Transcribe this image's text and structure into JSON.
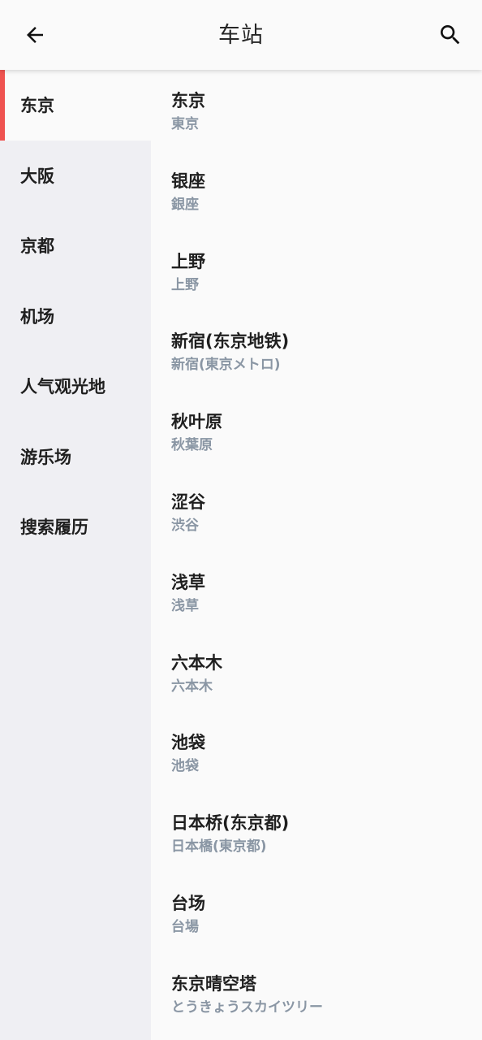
{
  "header": {
    "title": "车站",
    "back_icon": "back-arrow-icon",
    "search_icon": "search-icon"
  },
  "colors": {
    "accent": "#ef5350",
    "sidebar_bg": "#efeff3",
    "subtitle": "#8a96a4"
  },
  "sidebar": {
    "active_index": 0,
    "items": [
      {
        "label": "东京"
      },
      {
        "label": "大阪"
      },
      {
        "label": "京都"
      },
      {
        "label": "机场"
      },
      {
        "label": "人气观光地"
      },
      {
        "label": "游乐场"
      },
      {
        "label": "搜索履历"
      }
    ]
  },
  "stations": [
    {
      "name": "东京",
      "sub": "東京"
    },
    {
      "name": "银座",
      "sub": "銀座"
    },
    {
      "name": "上野",
      "sub": "上野"
    },
    {
      "name": "新宿(东京地铁)",
      "sub": "新宿(東京メトロ)"
    },
    {
      "name": "秋叶原",
      "sub": "秋葉原"
    },
    {
      "name": "涩谷",
      "sub": "渋谷"
    },
    {
      "name": "浅草",
      "sub": "浅草"
    },
    {
      "name": "六本木",
      "sub": "六本木"
    },
    {
      "name": "池袋",
      "sub": "池袋"
    },
    {
      "name": "日本桥(东京都)",
      "sub": "日本橋(東京都)"
    },
    {
      "name": "台场",
      "sub": "台場"
    },
    {
      "name": "东京晴空塔",
      "sub": "とうきょうスカイツリー"
    }
  ]
}
